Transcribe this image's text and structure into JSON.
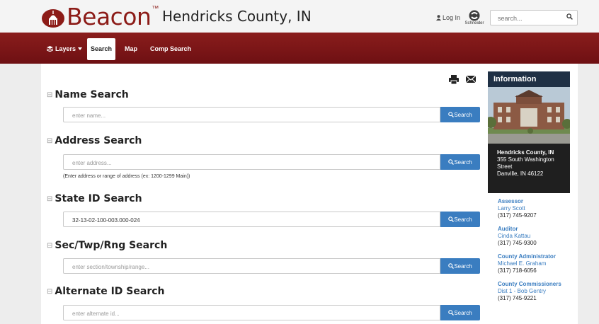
{
  "header": {
    "logo_text": "Beacon",
    "logo_tm": "™",
    "county_title": "Hendricks County, IN",
    "login_label": "Log In",
    "partner_label": "Schneider",
    "search_placeholder": "search..."
  },
  "nav": {
    "layers_label": "Layers",
    "search_label": "Search",
    "map_label": "Map",
    "comp_search_label": "Comp Search"
  },
  "sections": {
    "name": {
      "title": "Name Search",
      "placeholder": "enter name...",
      "button": "Search"
    },
    "address": {
      "title": "Address Search",
      "placeholder": "enter address...",
      "button": "Search",
      "hint": "(Enter address or range of address (ex: 1200-1299 Main))"
    },
    "state_id": {
      "title": "State ID Search",
      "value": "32-13-02-100-003.000-024",
      "button": "Search"
    },
    "sec_twp": {
      "title": "Sec/Twp/Rng Search",
      "placeholder": "enter section/township/range...",
      "button": "Search"
    },
    "alternate": {
      "title": "Alternate ID Search",
      "placeholder": "enter alternate id...",
      "button": "Search"
    }
  },
  "info": {
    "heading": "Information",
    "name": "Hendricks County, IN",
    "street1": "355 South Washington",
    "street2": "Street",
    "city": "Danville, IN 46122",
    "contacts": [
      {
        "title": "Assessor",
        "name": "Larry Scott",
        "phone": "(317) 745-9207"
      },
      {
        "title": "Auditor",
        "name": "Cinda Kattau",
        "phone": "(317) 745-9300"
      },
      {
        "title": "County Administrator",
        "name": "Michael E. Graham",
        "phone": "(317) 718-6056"
      },
      {
        "title": "County Commissioners",
        "name": "Dist 1 - Bob Gentry",
        "phone": "(317) 745-9221"
      }
    ]
  },
  "colors": {
    "brand": "#8c1b17",
    "nav": "#7b1416",
    "button": "#3a7dc0",
    "info_head": "#1f3045"
  }
}
